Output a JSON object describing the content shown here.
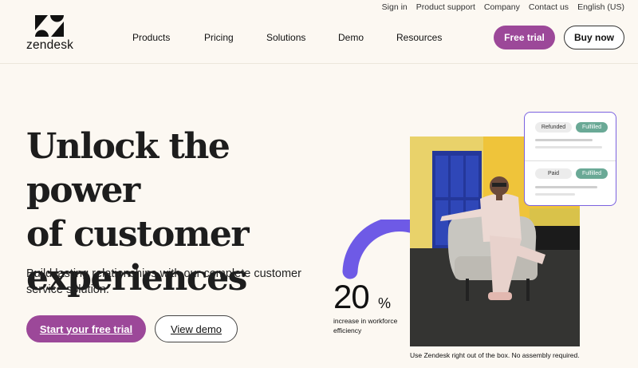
{
  "header": {
    "logo_text": "zendesk",
    "utility_nav": [
      "Sign in",
      "Product support",
      "Company",
      "Contact us",
      "English (US)"
    ],
    "main_nav": [
      "Products",
      "Pricing",
      "Solutions",
      "Demo",
      "Resources"
    ],
    "free_trial_label": "Free trial",
    "buy_now_label": "Buy now"
  },
  "hero": {
    "headline_lines": [
      "Unlock the power",
      "of customer",
      "experiences"
    ],
    "subtitle": "Build lasting relationships with our complete customer service solution.",
    "cta_primary": "Start your free trial",
    "cta_secondary": "View demo"
  },
  "stat": {
    "number": "20",
    "unit": "%",
    "label": "increase in workforce efficiency"
  },
  "caption": "Use Zendesk right out of the box. No assembly required.",
  "ticket_card": {
    "rows": [
      {
        "status": "Refunded",
        "state": "Fulfilled"
      },
      {
        "status": "Paid",
        "state": "Fulfilled"
      }
    ]
  },
  "colors": {
    "brand_purple": "#9c4899",
    "arc_purple": "#6e5ae6",
    "fulfilled_green": "#6aa996",
    "background": "#fcf8f2"
  }
}
